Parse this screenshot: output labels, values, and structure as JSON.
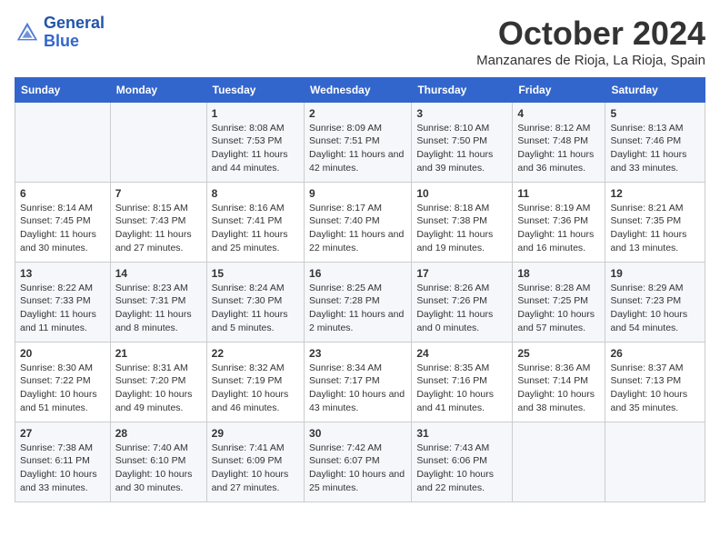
{
  "header": {
    "logo_line1": "General",
    "logo_line2": "Blue",
    "month": "October 2024",
    "location": "Manzanares de Rioja, La Rioja, Spain"
  },
  "weekdays": [
    "Sunday",
    "Monday",
    "Tuesday",
    "Wednesday",
    "Thursday",
    "Friday",
    "Saturday"
  ],
  "weeks": [
    [
      {
        "day": "",
        "info": ""
      },
      {
        "day": "",
        "info": ""
      },
      {
        "day": "1",
        "info": "Sunrise: 8:08 AM\nSunset: 7:53 PM\nDaylight: 11 hours and 44 minutes."
      },
      {
        "day": "2",
        "info": "Sunrise: 8:09 AM\nSunset: 7:51 PM\nDaylight: 11 hours and 42 minutes."
      },
      {
        "day": "3",
        "info": "Sunrise: 8:10 AM\nSunset: 7:50 PM\nDaylight: 11 hours and 39 minutes."
      },
      {
        "day": "4",
        "info": "Sunrise: 8:12 AM\nSunset: 7:48 PM\nDaylight: 11 hours and 36 minutes."
      },
      {
        "day": "5",
        "info": "Sunrise: 8:13 AM\nSunset: 7:46 PM\nDaylight: 11 hours and 33 minutes."
      }
    ],
    [
      {
        "day": "6",
        "info": "Sunrise: 8:14 AM\nSunset: 7:45 PM\nDaylight: 11 hours and 30 minutes."
      },
      {
        "day": "7",
        "info": "Sunrise: 8:15 AM\nSunset: 7:43 PM\nDaylight: 11 hours and 27 minutes."
      },
      {
        "day": "8",
        "info": "Sunrise: 8:16 AM\nSunset: 7:41 PM\nDaylight: 11 hours and 25 minutes."
      },
      {
        "day": "9",
        "info": "Sunrise: 8:17 AM\nSunset: 7:40 PM\nDaylight: 11 hours and 22 minutes."
      },
      {
        "day": "10",
        "info": "Sunrise: 8:18 AM\nSunset: 7:38 PM\nDaylight: 11 hours and 19 minutes."
      },
      {
        "day": "11",
        "info": "Sunrise: 8:19 AM\nSunset: 7:36 PM\nDaylight: 11 hours and 16 minutes."
      },
      {
        "day": "12",
        "info": "Sunrise: 8:21 AM\nSunset: 7:35 PM\nDaylight: 11 hours and 13 minutes."
      }
    ],
    [
      {
        "day": "13",
        "info": "Sunrise: 8:22 AM\nSunset: 7:33 PM\nDaylight: 11 hours and 11 minutes."
      },
      {
        "day": "14",
        "info": "Sunrise: 8:23 AM\nSunset: 7:31 PM\nDaylight: 11 hours and 8 minutes."
      },
      {
        "day": "15",
        "info": "Sunrise: 8:24 AM\nSunset: 7:30 PM\nDaylight: 11 hours and 5 minutes."
      },
      {
        "day": "16",
        "info": "Sunrise: 8:25 AM\nSunset: 7:28 PM\nDaylight: 11 hours and 2 minutes."
      },
      {
        "day": "17",
        "info": "Sunrise: 8:26 AM\nSunset: 7:26 PM\nDaylight: 11 hours and 0 minutes."
      },
      {
        "day": "18",
        "info": "Sunrise: 8:28 AM\nSunset: 7:25 PM\nDaylight: 10 hours and 57 minutes."
      },
      {
        "day": "19",
        "info": "Sunrise: 8:29 AM\nSunset: 7:23 PM\nDaylight: 10 hours and 54 minutes."
      }
    ],
    [
      {
        "day": "20",
        "info": "Sunrise: 8:30 AM\nSunset: 7:22 PM\nDaylight: 10 hours and 51 minutes."
      },
      {
        "day": "21",
        "info": "Sunrise: 8:31 AM\nSunset: 7:20 PM\nDaylight: 10 hours and 49 minutes."
      },
      {
        "day": "22",
        "info": "Sunrise: 8:32 AM\nSunset: 7:19 PM\nDaylight: 10 hours and 46 minutes."
      },
      {
        "day": "23",
        "info": "Sunrise: 8:34 AM\nSunset: 7:17 PM\nDaylight: 10 hours and 43 minutes."
      },
      {
        "day": "24",
        "info": "Sunrise: 8:35 AM\nSunset: 7:16 PM\nDaylight: 10 hours and 41 minutes."
      },
      {
        "day": "25",
        "info": "Sunrise: 8:36 AM\nSunset: 7:14 PM\nDaylight: 10 hours and 38 minutes."
      },
      {
        "day": "26",
        "info": "Sunrise: 8:37 AM\nSunset: 7:13 PM\nDaylight: 10 hours and 35 minutes."
      }
    ],
    [
      {
        "day": "27",
        "info": "Sunrise: 7:38 AM\nSunset: 6:11 PM\nDaylight: 10 hours and 33 minutes."
      },
      {
        "day": "28",
        "info": "Sunrise: 7:40 AM\nSunset: 6:10 PM\nDaylight: 10 hours and 30 minutes."
      },
      {
        "day": "29",
        "info": "Sunrise: 7:41 AM\nSunset: 6:09 PM\nDaylight: 10 hours and 27 minutes."
      },
      {
        "day": "30",
        "info": "Sunrise: 7:42 AM\nSunset: 6:07 PM\nDaylight: 10 hours and 25 minutes."
      },
      {
        "day": "31",
        "info": "Sunrise: 7:43 AM\nSunset: 6:06 PM\nDaylight: 10 hours and 22 minutes."
      },
      {
        "day": "",
        "info": ""
      },
      {
        "day": "",
        "info": ""
      }
    ]
  ]
}
